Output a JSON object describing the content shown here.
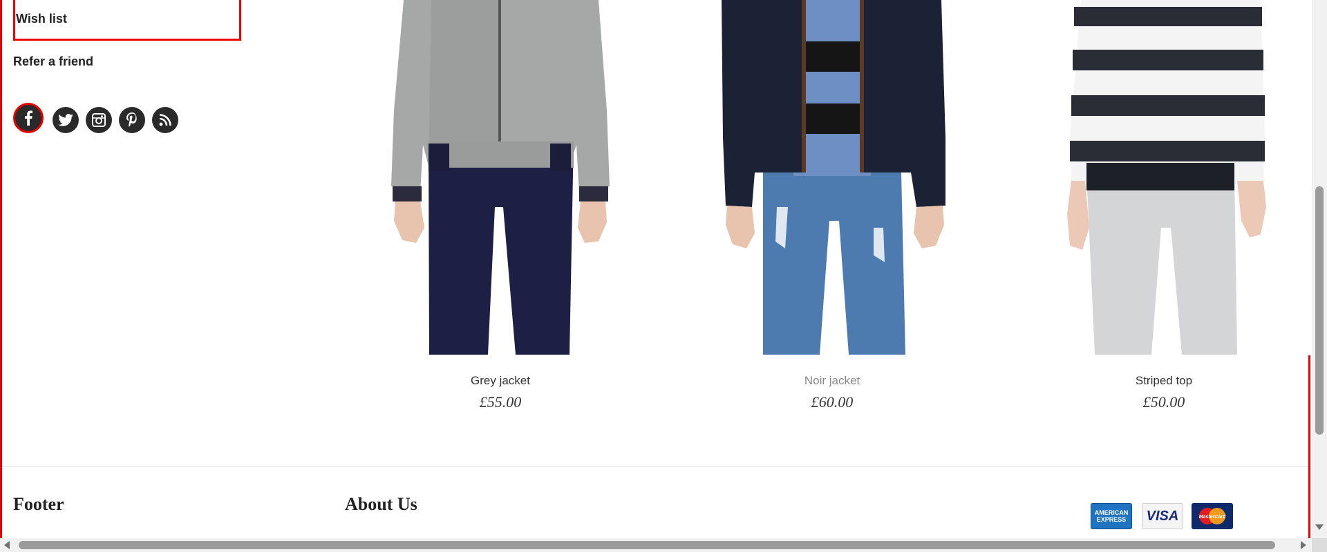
{
  "sidebar": {
    "wish_list_label": "Wish list",
    "refer_friend_label": "Refer a friend",
    "social_icons": [
      "facebook-icon",
      "twitter-icon",
      "instagram-icon",
      "pinterest-icon",
      "rss-icon"
    ]
  },
  "products": [
    {
      "name": "Grey jacket",
      "price": "£55.00"
    },
    {
      "name": "Noir jacket",
      "price": "£60.00"
    },
    {
      "name": "Striped top",
      "price": "£50.00"
    }
  ],
  "footer": {
    "column1_title": "Footer",
    "column2_title": "About Us",
    "payment_cards": [
      "amex-card-icon",
      "visa-card-icon",
      "mastercard-card-icon"
    ],
    "amex_text": "AMERICAN EXPRESS",
    "visa_text": "VISA",
    "mastercard_text": "MasterCard"
  },
  "colors": {
    "focus_outline": "#e00000",
    "icon_dark": "#2a2a2a"
  }
}
